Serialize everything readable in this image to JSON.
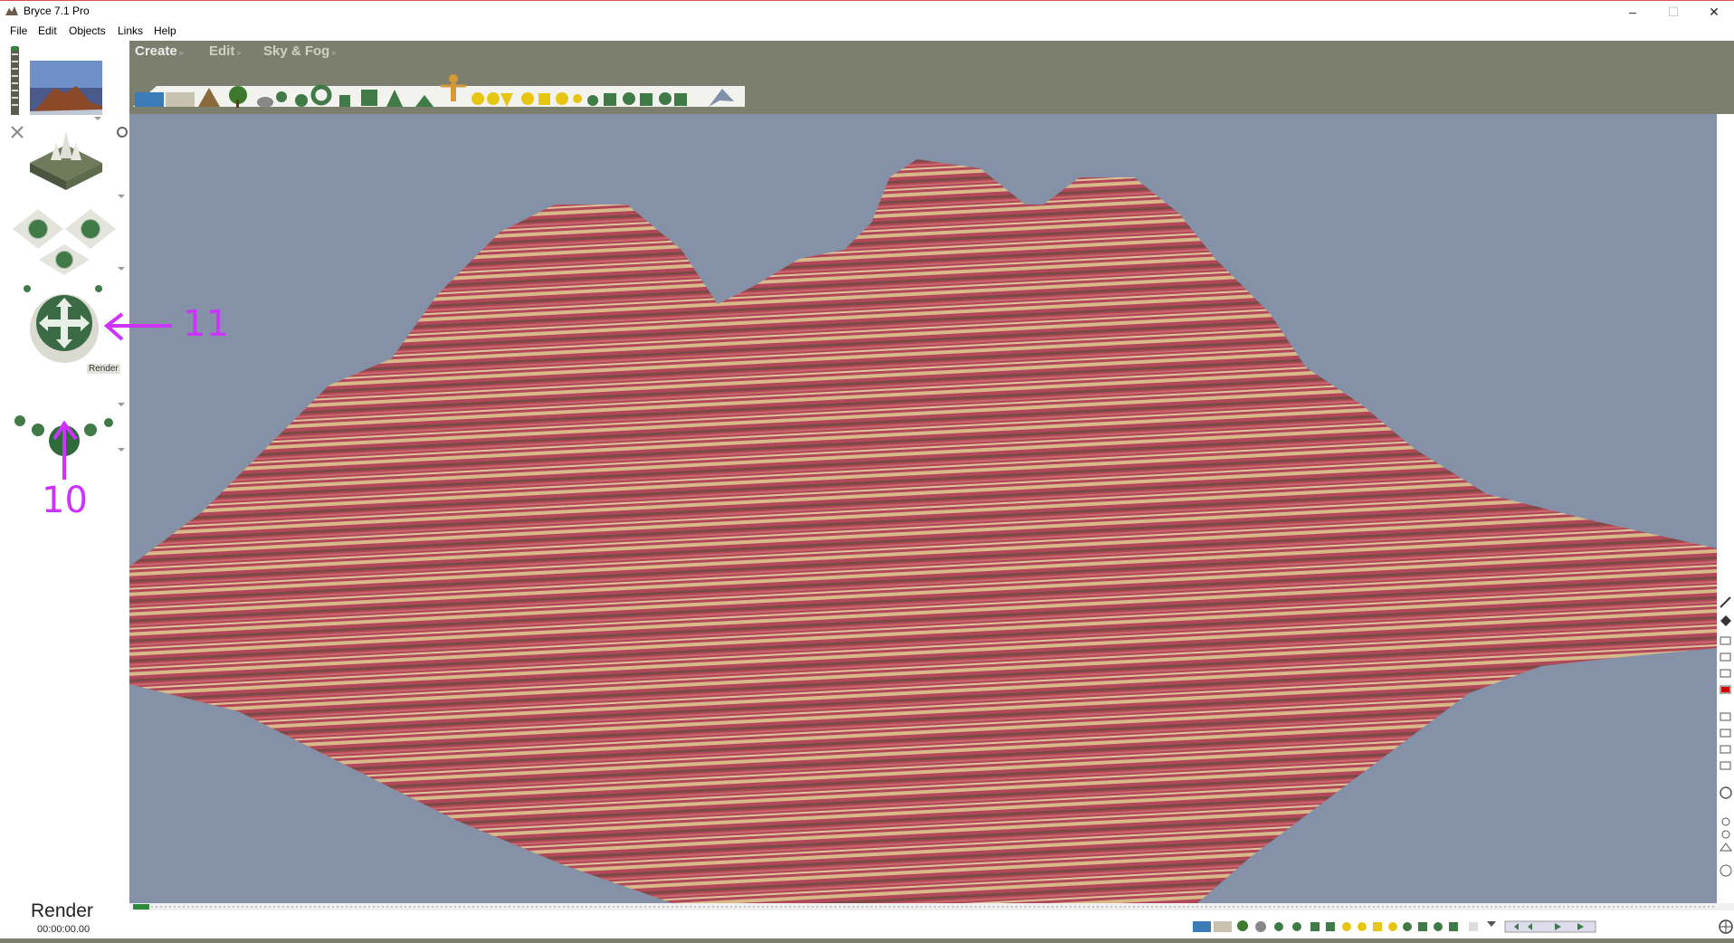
{
  "window": {
    "title": "Bryce 7.1  Pro",
    "minimize": "–",
    "maximize": "☐",
    "close": "✕"
  },
  "menu": {
    "items": [
      "File",
      "Edit",
      "Objects",
      "Links",
      "Help"
    ]
  },
  "palette": {
    "tabs": [
      "Create",
      "Edit",
      "Sky & Fog"
    ]
  },
  "control": {
    "render_tooltip": "Render"
  },
  "status": {
    "label": "Render",
    "time": "00:00:00.00"
  },
  "annotations": {
    "num_11": "11",
    "num_10": "10",
    "color": "#cc33ff"
  },
  "colors": {
    "terrain_red": "#b0485a",
    "terrain_tan": "#d9b98a",
    "sky": "#8591a6",
    "chrome": "#7d7f6e"
  },
  "icons": [
    "bryce-app-icon",
    "terrain-icon",
    "tree-icon",
    "rock-icon",
    "sphere-icon",
    "cube-icon",
    "torus-icon",
    "cone-icon",
    "human-figure-icon",
    "light-icon",
    "plane-icon",
    "trackball-icon",
    "render-sphere-icon",
    "cross-move-icon"
  ]
}
